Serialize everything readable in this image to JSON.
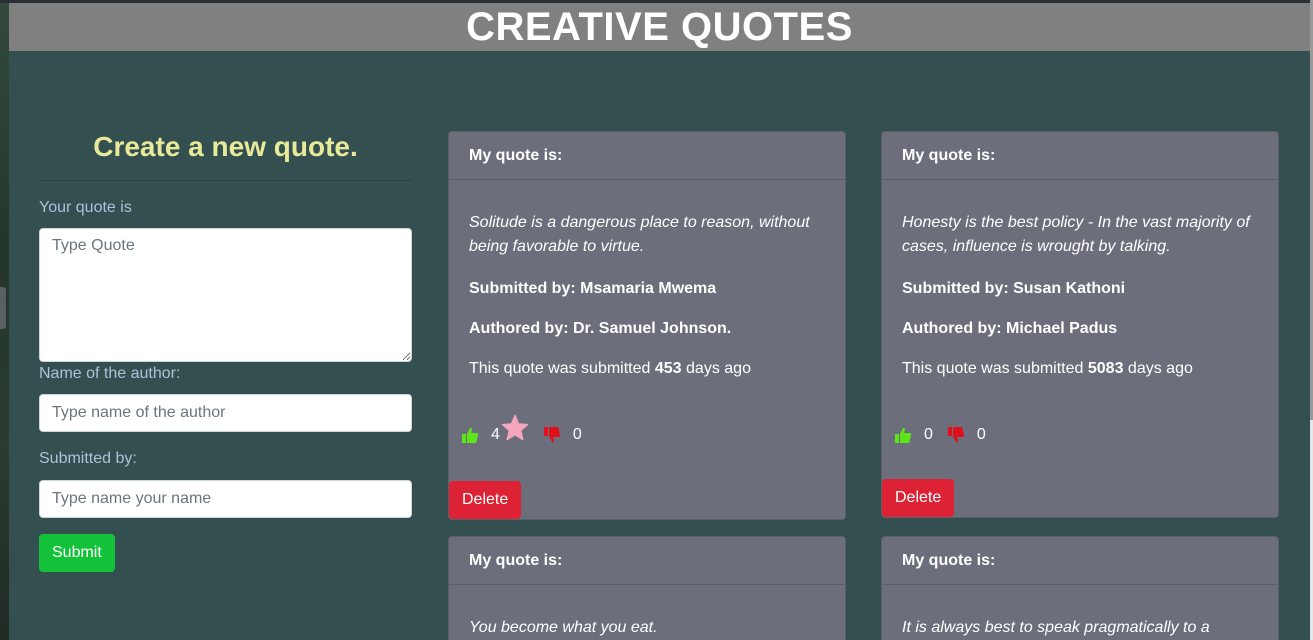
{
  "app": {
    "title": "CREATIVE QUOTES"
  },
  "form": {
    "title": "Create a new quote.",
    "quote_label": "Your quote is",
    "quote_placeholder": "Type Quote",
    "author_label": "Name of the author:",
    "author_placeholder": "Type name of the author",
    "submitter_label": "Submitted by:",
    "submitter_placeholder": "Type name your name",
    "submit_label": "Submit"
  },
  "quotes": [
    {
      "header": "My quote is:",
      "text": "Solitude is a dangerous place to reason, without being favorable to virtue.",
      "submitted_by": "Submitted by: Msamaria Mwema",
      "authored_by": "Authored by: Dr. Samuel Johnson.",
      "age_prefix": "This quote was submitted",
      "age_days": "453",
      "age_suffix": "days ago",
      "likes": "4",
      "dislikes": "0",
      "featured": true,
      "delete_label": "Delete"
    },
    {
      "header": "My quote is:",
      "text": "Honesty is the best policy - In the vast majority of cases, influence is wrought by talking.",
      "submitted_by": "Submitted by: Susan Kathoni",
      "authored_by": "Authored by: Michael Padus",
      "age_prefix": "This quote was submitted",
      "age_days": "5083",
      "age_suffix": "days ago",
      "likes": "0",
      "dislikes": "0",
      "featured": false,
      "delete_label": "Delete"
    },
    {
      "header": "My quote is:",
      "text": "You become what you eat."
    },
    {
      "header": "My quote is:",
      "text": "It is always best to speak pragmatically to a"
    }
  ],
  "colors": {
    "header_bg": "#808080",
    "page_bg": "#344f50",
    "form_title": "#e8ea9a",
    "label": "#a9c4d8",
    "card_bg": "#6c6f7b",
    "submit": "#14c23a",
    "delete": "#dc2234",
    "like": "#5ee51a",
    "dislike": "#e0101a",
    "star": "#f4a6bd"
  },
  "icons": {
    "like": "thumbs-up-icon",
    "dislike": "thumbs-down-icon",
    "star": "star-icon"
  }
}
